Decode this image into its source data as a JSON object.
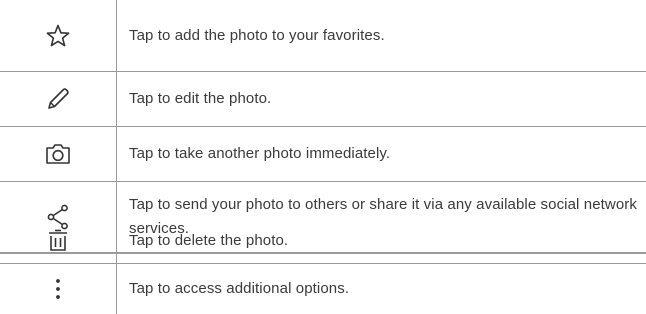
{
  "rows": [
    {
      "icon": "star-icon",
      "text": "Tap to add the photo to your favorites."
    },
    {
      "icon": "pencil-icon",
      "text": "Tap to edit the photo."
    },
    {
      "icon": "camera-icon",
      "text": "Tap to take another photo immediately."
    },
    {
      "icon": "share-icon",
      "text": "Tap to send your photo to others or share it via any available social network services."
    },
    {
      "icon": "trash-icon",
      "text": "Tap to delete the photo."
    },
    {
      "icon": "more-options-icon",
      "text": "Tap to access additional options."
    }
  ]
}
